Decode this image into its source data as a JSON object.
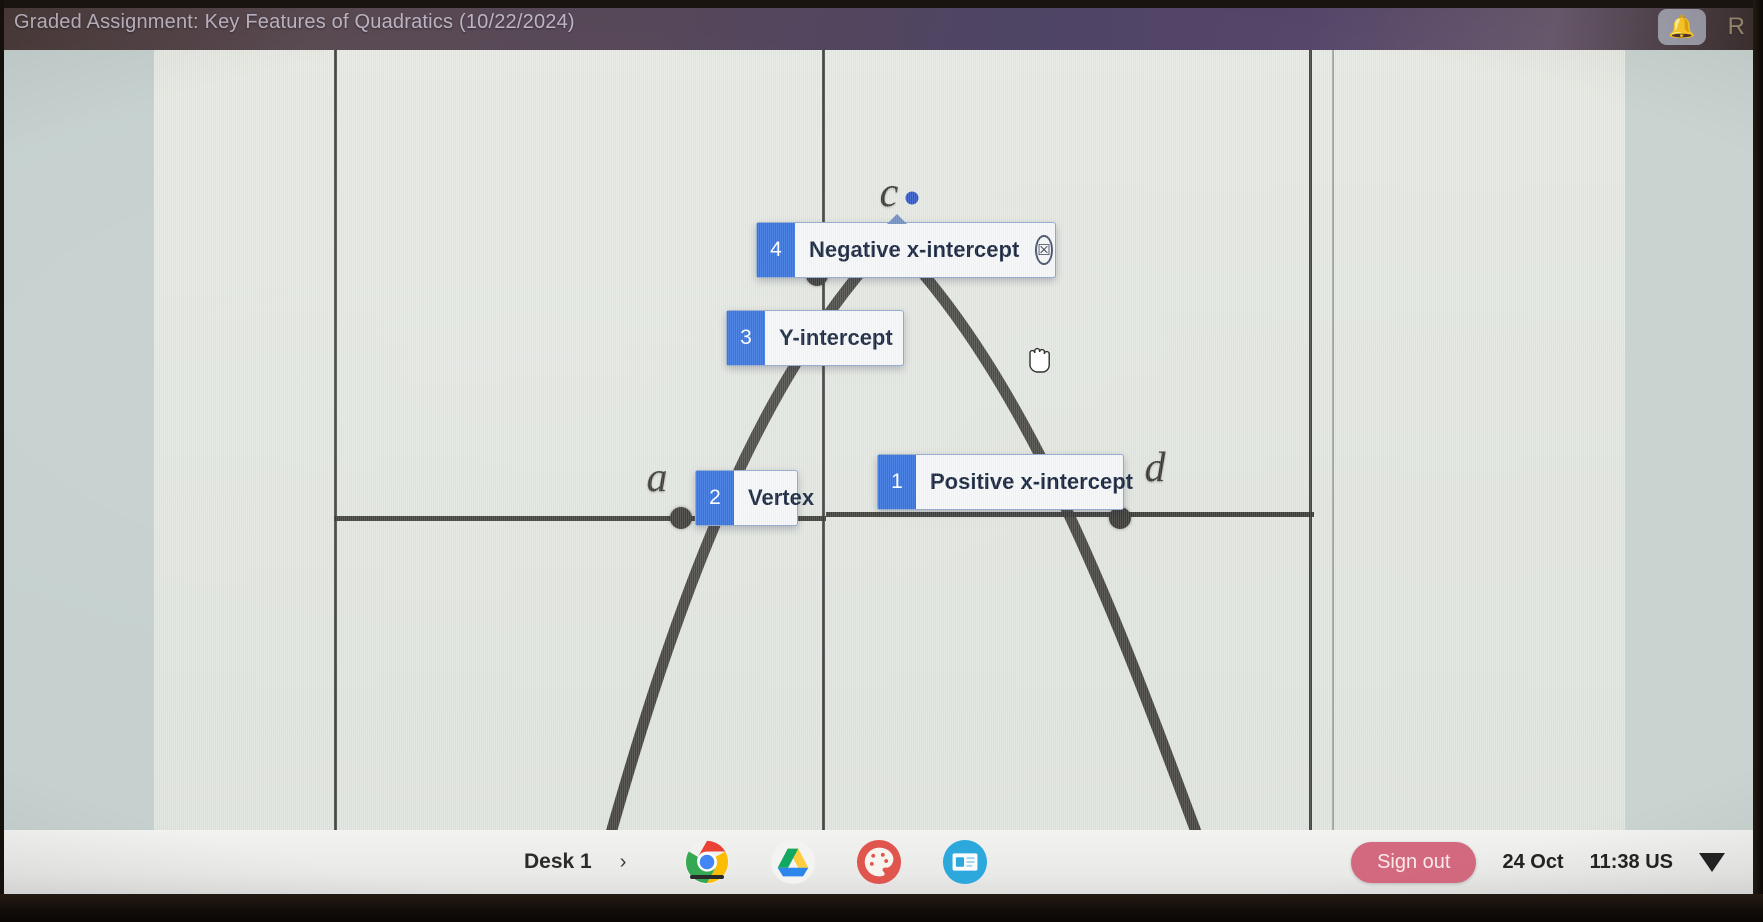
{
  "titlebar": {
    "title": "Graded Assignment: Key Features of Quadratics (10/22/2024)",
    "notification_icon": "bell-icon",
    "notification_glyph": "ὑ4",
    "avatar_letter": "R"
  },
  "graph": {
    "point_labels": [
      {
        "id": "a",
        "text": "a"
      },
      {
        "id": "c",
        "text": "c"
      },
      {
        "id": "d",
        "text": "d"
      }
    ],
    "cursor_icon": "grab-hand-cursor"
  },
  "cards": [
    {
      "number": "4",
      "label": "Negative x-intercept",
      "has_trash": true,
      "trash_icon": "trash-icon",
      "trash_glyph": "␣"
    },
    {
      "number": "3",
      "label": "Y-intercept",
      "has_trash": false
    },
    {
      "number": "2",
      "label": "Vertex",
      "has_trash": false
    },
    {
      "number": "1",
      "label": "Positive x-intercept",
      "has_trash": false
    }
  ],
  "shelf": {
    "desk_label": "Desk 1",
    "desk_chevron": "›",
    "apps": [
      {
        "name": "chrome-icon"
      },
      {
        "name": "google-drive-icon"
      },
      {
        "name": "palette-icon"
      },
      {
        "name": "id-card-icon"
      }
    ],
    "sign_out": "Sign out",
    "date": "24 Oct",
    "time": "11:38 US",
    "status_icon": "wifi-icon"
  },
  "colors": {
    "card_badge_blue": "#2f6fe0",
    "card_border": "#8fa6cf",
    "sign_out_pink": "#d2697f",
    "curve_dark": "#3b3a36"
  }
}
